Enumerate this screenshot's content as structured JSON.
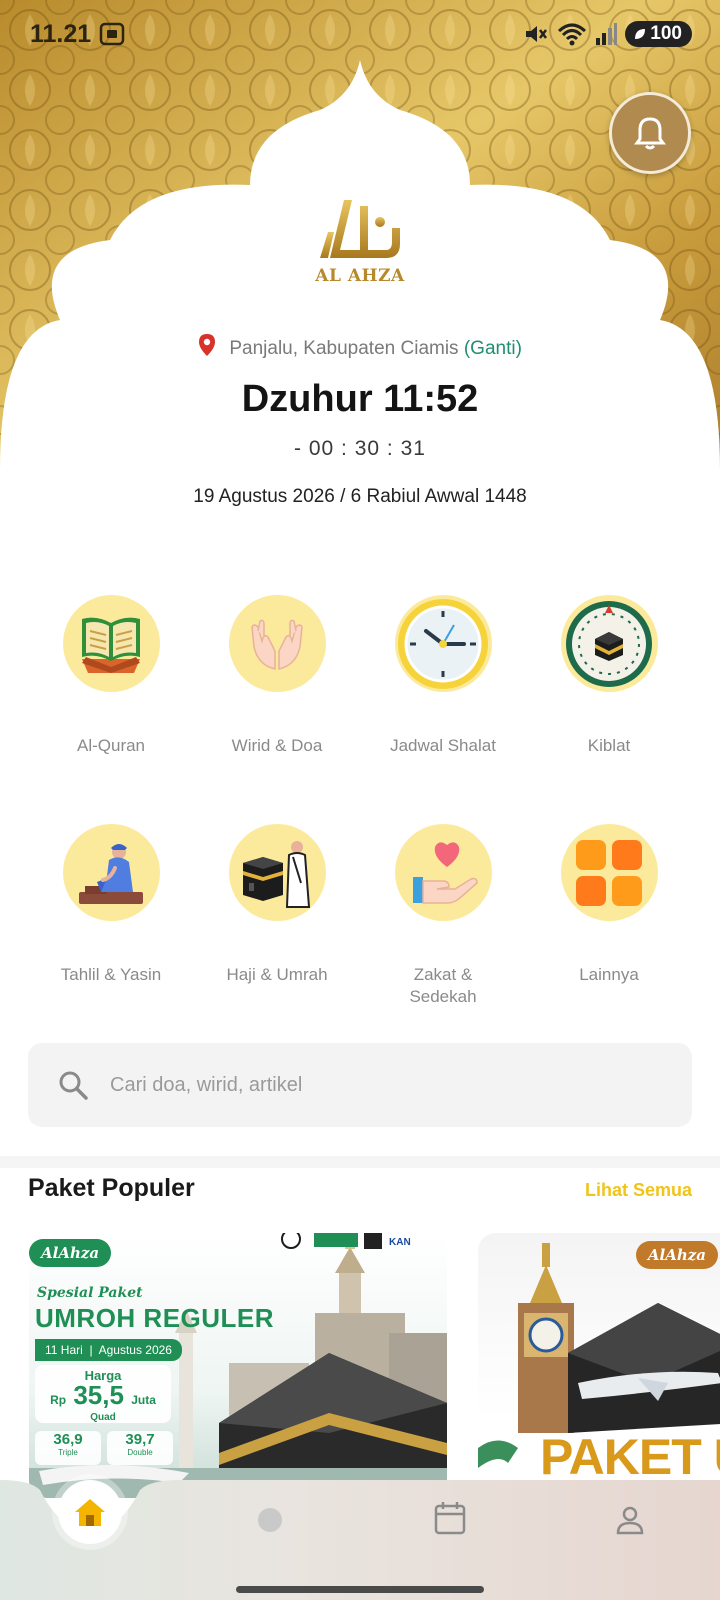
{
  "status_bar": {
    "time": "11.21",
    "battery": "100"
  },
  "header": {
    "logo_text": "AL AHZA",
    "location": "Panjalu, Kabupaten Ciamis",
    "change_label": "(Ganti)",
    "prayer": "Dzuhur 11:52",
    "countdown": "- 00 : 30 : 31",
    "date": "19 Agustus 2026 / 6 Rabiul Awwal 1448"
  },
  "menu": {
    "items": [
      {
        "label": "Al-Quran",
        "icon": "quran-icon"
      },
      {
        "label": "Wirid & Doa",
        "icon": "praying-hands-icon"
      },
      {
        "label": "Jadwal Shalat",
        "icon": "clock-icon"
      },
      {
        "label": "Kiblat",
        "icon": "compass-icon"
      },
      {
        "label": "Tahlil & Yasin",
        "icon": "praying-person-icon"
      },
      {
        "label": "Haji & Umrah",
        "icon": "kaaba-pilgrim-icon"
      },
      {
        "label": "Zakat &\nSedekah",
        "icon": "heart-hand-icon"
      },
      {
        "label": "Lainnya",
        "icon": "grid-icon"
      }
    ]
  },
  "search": {
    "placeholder": "Cari doa, wirid, artikel"
  },
  "packages": {
    "title": "Paket Populer",
    "see_all": "Lihat Semua",
    "cards": [
      {
        "badge": "AlAhza",
        "subtitle": "Spesial Paket",
        "title": "UMROH REGULER",
        "duration": "11 Hari",
        "month": "Agustus 2026",
        "price_label": "Harga",
        "price_currency": "Rp",
        "price": "35,5",
        "price_unit": "Juta",
        "price_type": "Quad",
        "price_triple": "36,9",
        "price_triple_label": "Triple",
        "price_double": "39,7",
        "price_double_label": "Double",
        "partner_logos": [
          "SISKO PATUH",
          "KAN"
        ]
      },
      {
        "badge": "AlAhza",
        "title": "PAKET UM"
      }
    ]
  },
  "colors": {
    "gold": "#c9a042",
    "green": "#1f8f55",
    "accent_yellow": "#f0c419",
    "icon_bg": "#fcea9c"
  }
}
